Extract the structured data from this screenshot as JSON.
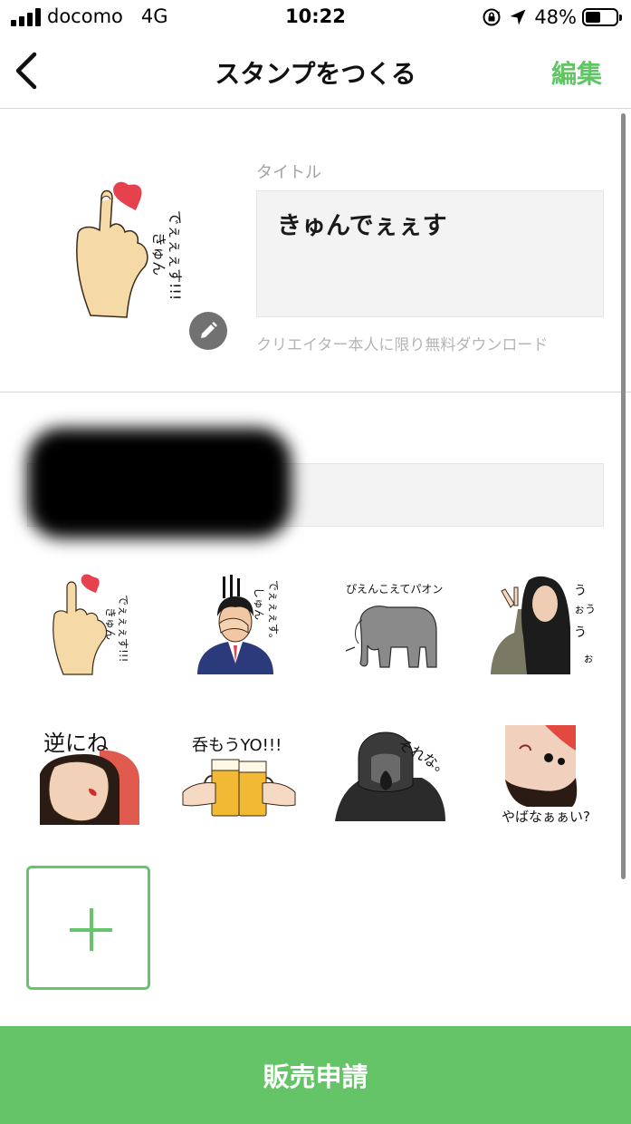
{
  "status_bar": {
    "carrier": "docomo",
    "network": "4G",
    "time": "10:22",
    "battery": "48%",
    "battery_level": 0.48
  },
  "nav": {
    "title": "スタンプをつくる",
    "edit_label": "編集",
    "back_icon": "chevron-left-icon"
  },
  "title_section": {
    "label": "タイトル",
    "value": "きゅんでぇぇす",
    "note": "クリエイター本人に限り無料ダウンロード",
    "edit_icon": "pencil-icon"
  },
  "description_section": {
    "redacted": true
  },
  "stickers": [
    {
      "id": "kyun",
      "caption": "きゅんでぇぇぇす!!!"
    },
    {
      "id": "shun",
      "caption": "しゅんでぇぇぇす。"
    },
    {
      "id": "elephant",
      "caption": "ぴえんこえてパオン"
    },
    {
      "id": "woman-v",
      "caption": "うぉうぅうぉ"
    },
    {
      "id": "gyaku",
      "caption": "逆にね"
    },
    {
      "id": "beer",
      "caption": "呑もうYO!!!"
    },
    {
      "id": "gorilla",
      "caption": "それな。"
    },
    {
      "id": "yabai",
      "caption": "やばなぁぁい?"
    }
  ],
  "add_sticker_icon": "plus-icon",
  "colors": {
    "accent": "#65c467",
    "heart": "#e5424e"
  },
  "submit": {
    "label": "販売申請"
  }
}
